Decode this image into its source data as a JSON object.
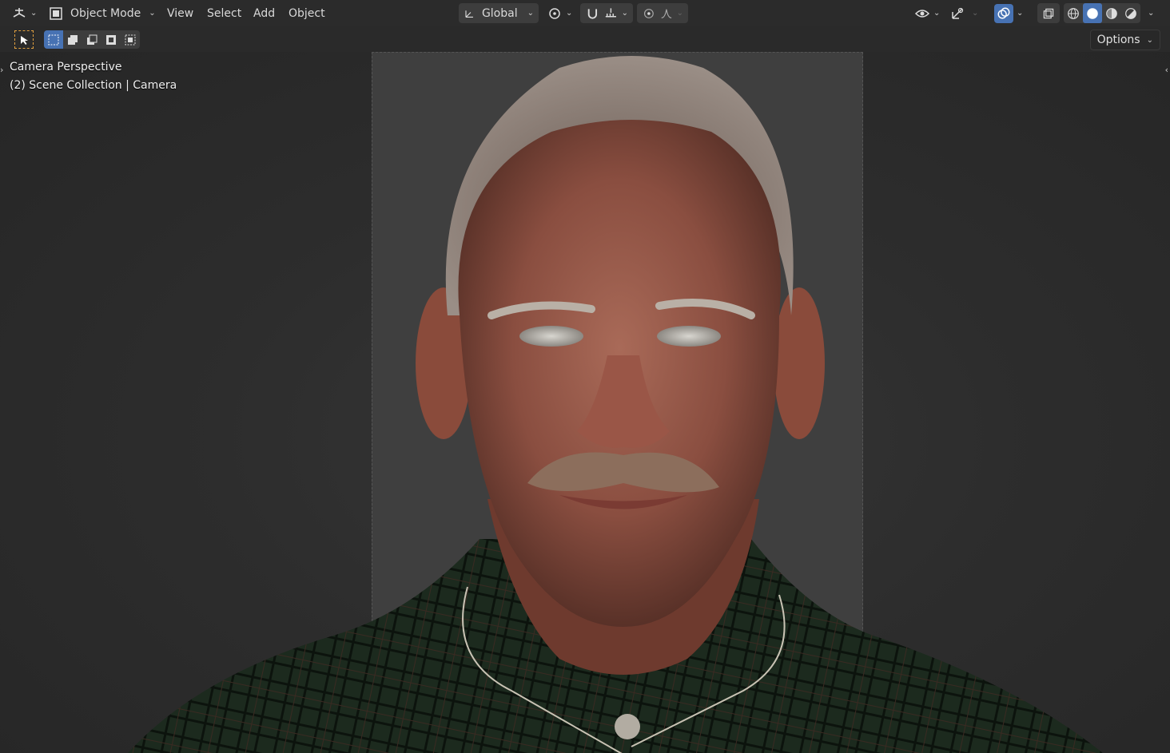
{
  "header": {
    "editor_type_icon": "viewport-icon",
    "mode_label": "Object Mode",
    "menus": [
      "View",
      "Select",
      "Add",
      "Object"
    ],
    "transform_orientation": "Global",
    "options_label": "Options"
  },
  "viewport": {
    "overlay_line1": "Camera Perspective",
    "overlay_line2": "(2) Scene Collection | Camera"
  },
  "colors": {
    "accent": "#4772b3",
    "background": "#2a2a2a",
    "camera_frame": "#3f3f3f"
  }
}
